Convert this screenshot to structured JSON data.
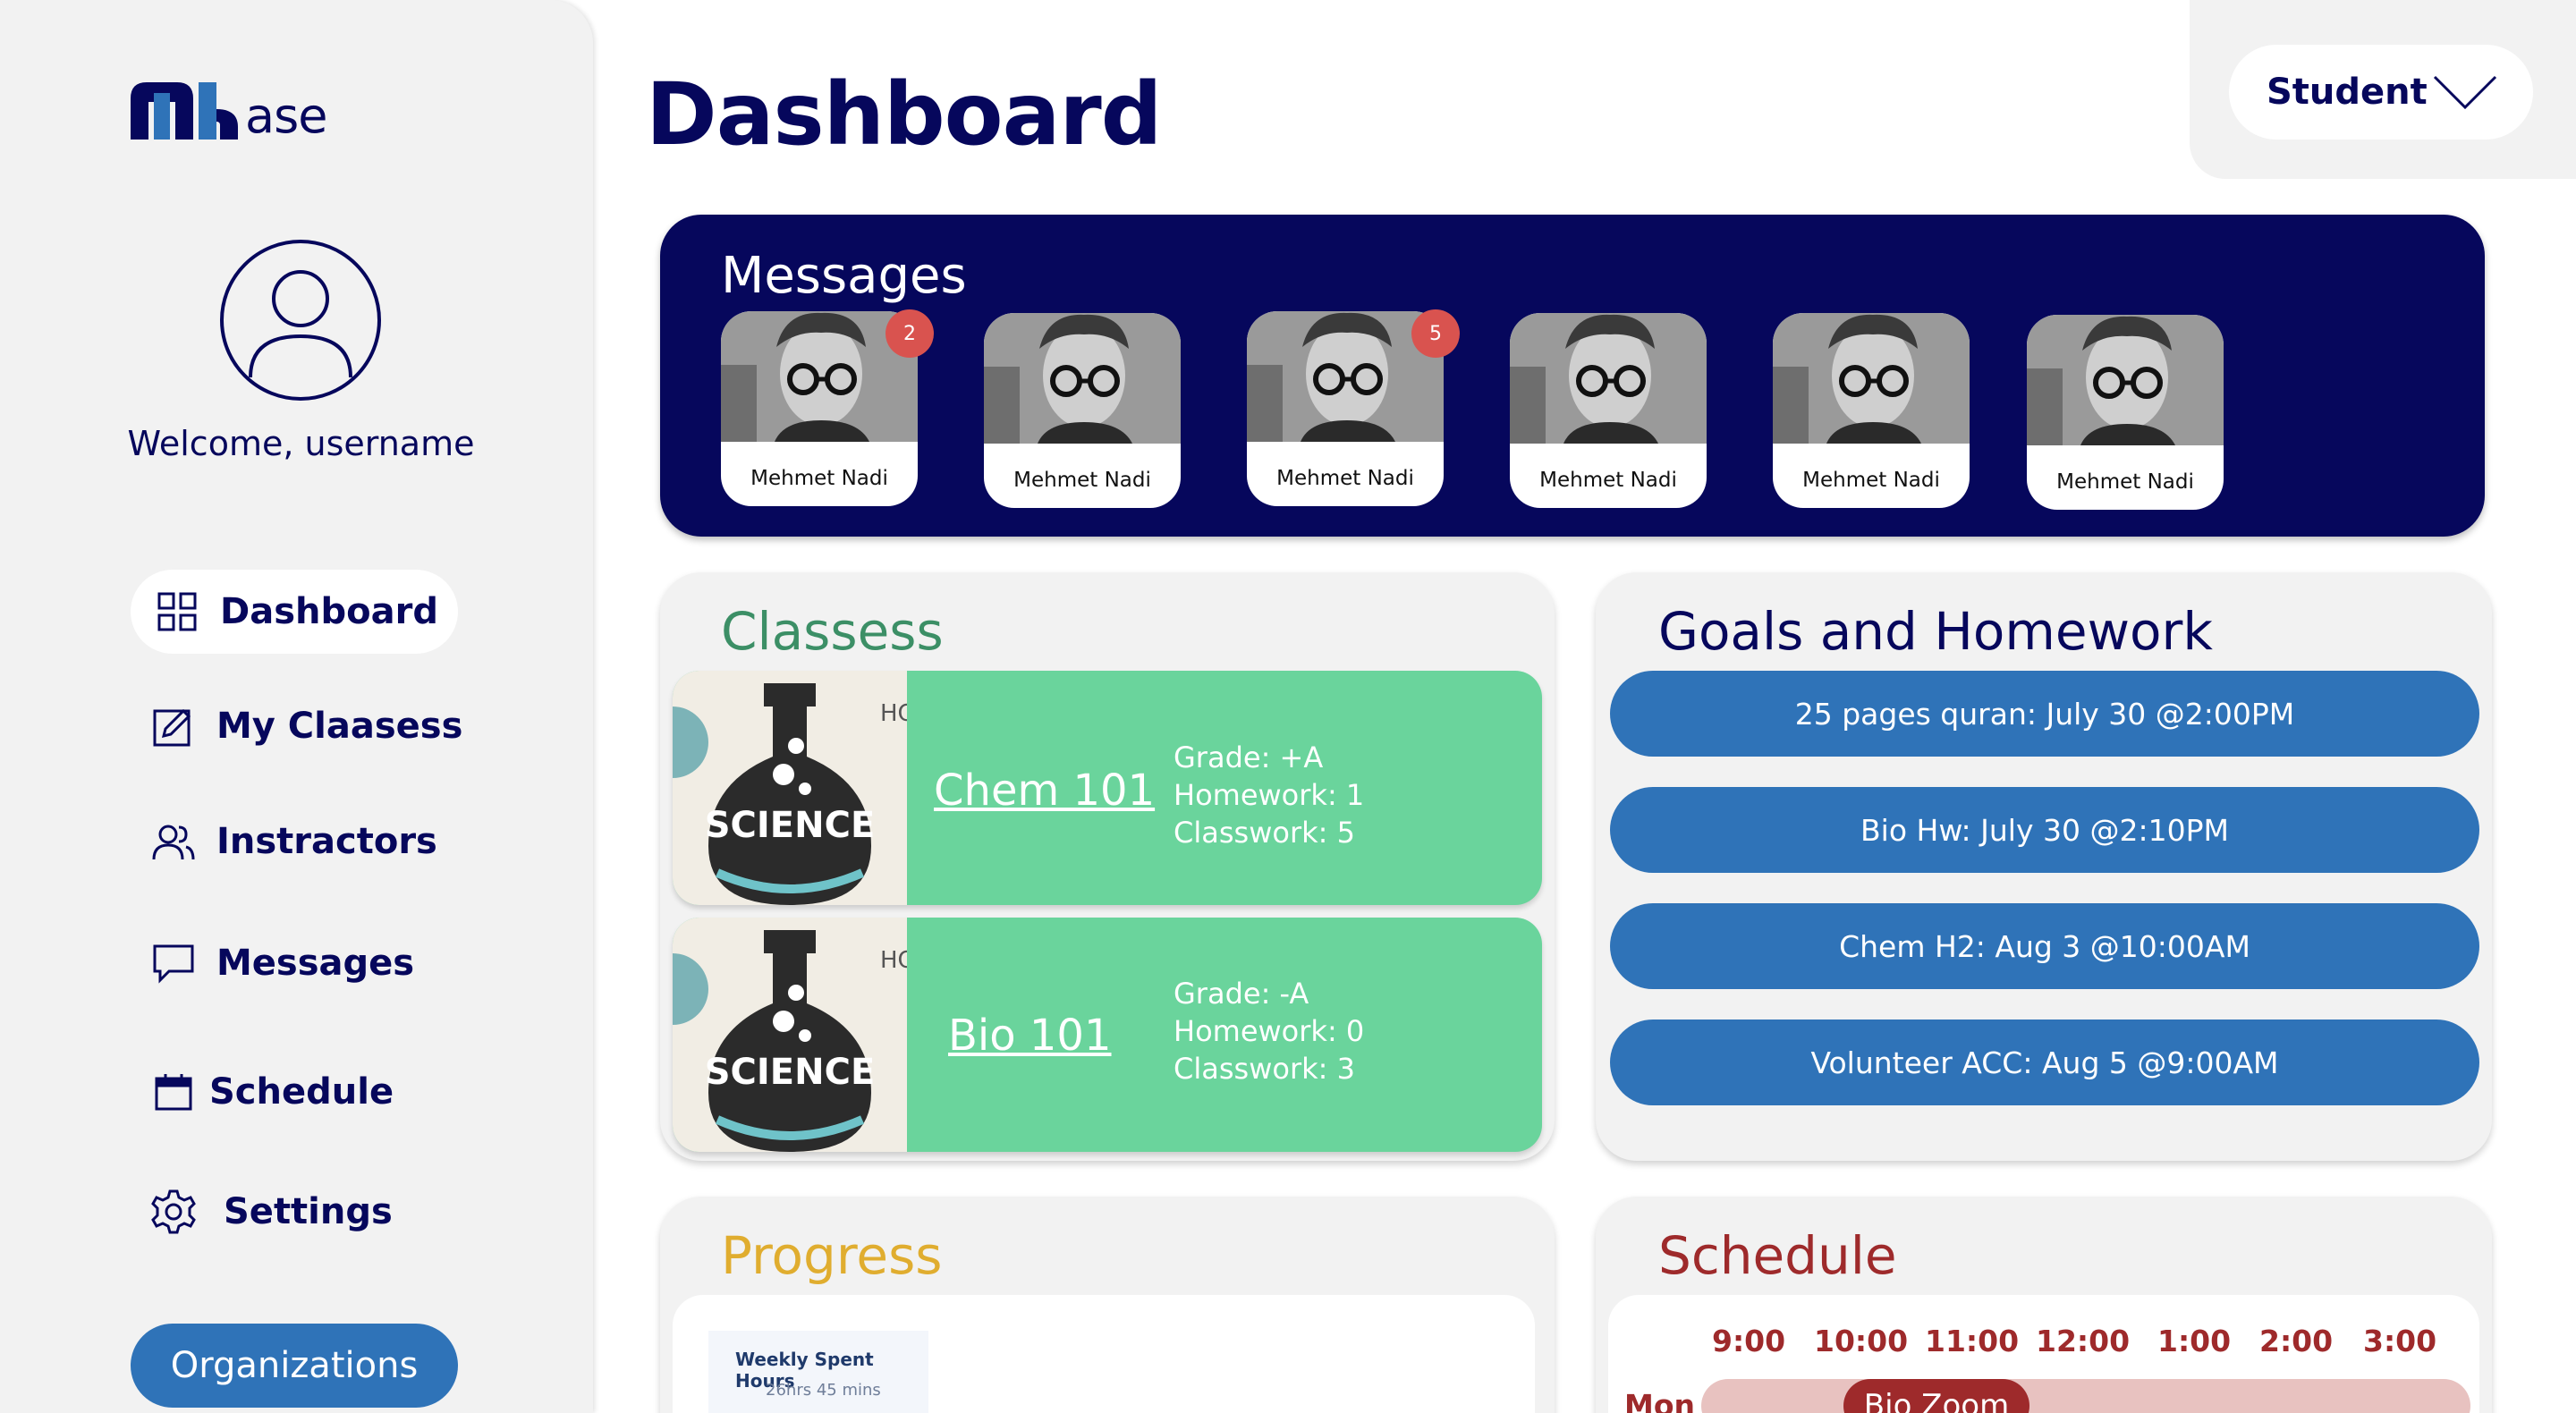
{
  "app": {
    "logo_text": "ase",
    "welcome": "Welcome, username"
  },
  "sidebar": {
    "items": [
      {
        "label": "Dashboard",
        "icon": "grid-icon",
        "active": true
      },
      {
        "label": "My Claasess",
        "icon": "edit-square-icon"
      },
      {
        "label": "Instractors",
        "icon": "users-icon"
      },
      {
        "label": "Messages",
        "icon": "chat-bubble-icon"
      },
      {
        "label": "Schedule",
        "icon": "calendar-icon"
      },
      {
        "label": "Settings",
        "icon": "gear-icon"
      }
    ],
    "organizations_label": "Organizations"
  },
  "header": {
    "title": "Dashboard",
    "role": "Student"
  },
  "messages": {
    "title": "Messages",
    "contacts": [
      {
        "name": "Mehmet Nadi",
        "badge": "2"
      },
      {
        "name": "Mehmet Nadi",
        "badge": ""
      },
      {
        "name": "Mehmet Nadi",
        "badge": "5"
      },
      {
        "name": "Mehmet Nadi",
        "badge": ""
      },
      {
        "name": "Mehmet Nadi",
        "badge": ""
      },
      {
        "name": "Mehmet Nadi",
        "badge": ""
      }
    ]
  },
  "classes": {
    "title": "Classess",
    "image_text": "SCIENCE",
    "image_corner_text": "HC",
    "items": [
      {
        "name": "Chem 101",
        "grade": "Grade: +A",
        "homework": "Homework: 1",
        "classwork": "Classwork: 5"
      },
      {
        "name": "Bio 101",
        "grade": "Grade: -A",
        "homework": "Homework: 0",
        "classwork": "Classwork: 3"
      }
    ]
  },
  "goals": {
    "title": "Goals and Homework",
    "items": [
      "25 pages quran: July 30 @2:00PM",
      "Bio Hw: July 30 @2:10PM",
      "Chem H2: Aug 3 @10:00AM",
      "Volunteer ACC: Aug 5 @9:00AM"
    ]
  },
  "progress": {
    "title": "Progress",
    "weekly_title": "Weekly Spent Hours",
    "weekly_value": "26hrs 45 mins"
  },
  "schedule": {
    "title": "Schedule",
    "times": [
      "9:00",
      "10:00",
      "11:00",
      "12:00",
      "1:00",
      "2:00",
      "3:00"
    ],
    "day": "Mon",
    "event": "Bio Zoom"
  },
  "colors": {
    "navy": "#06075c",
    "blue": "#2f73b8",
    "green": "#6ad49c",
    "green_title": "#3c8f66",
    "gold": "#e0ad2f",
    "maroon": "#9e2a2b",
    "panel": "#f2f2f2"
  }
}
